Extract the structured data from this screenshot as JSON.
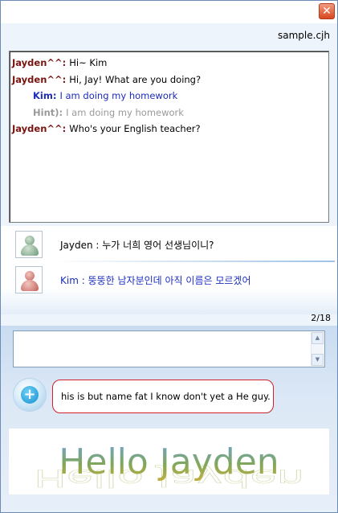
{
  "window": {
    "close_label": "✕",
    "file_name": "sample.cjh"
  },
  "chat_log": [
    {
      "speaker": "Jayden^^:",
      "text": "Hi~ Kim",
      "kind": "jay"
    },
    {
      "speaker": "Jayden^^:",
      "text": "Hi, Jay! What are you doing?",
      "kind": "jay"
    },
    {
      "speaker": "Kim:",
      "text": "I am doing my homework",
      "kind": "kim"
    },
    {
      "speaker": "Hint):",
      "text": "I am doing my homework",
      "kind": "hint"
    },
    {
      "speaker": "Jayden^^:",
      "text": "Who's your English teacher?",
      "kind": "jay"
    }
  ],
  "transcript": [
    {
      "avatar": "green-user-icon",
      "text": "Jayden : 누가 너희 영어 선생님이니?"
    },
    {
      "avatar": "red-user-icon",
      "text": "Kim : 뚱뚱한 남자분인데 아직 이름은 모르겠어"
    }
  ],
  "counter": "2/18",
  "input": {
    "value": "",
    "placeholder": ""
  },
  "answer": {
    "button_icon": "plus-circle-icon",
    "button_label": "+",
    "text": "his is but name fat I know don't yet a He guy."
  },
  "banner": {
    "text": "Hello Jayden"
  },
  "colors": {
    "speaker_jay": "#7a1410",
    "speaker_kim": "#1c2bbd",
    "hint": "#9a9a9a",
    "bubble_border": "#d0202a",
    "close_button": "#d9471f"
  }
}
